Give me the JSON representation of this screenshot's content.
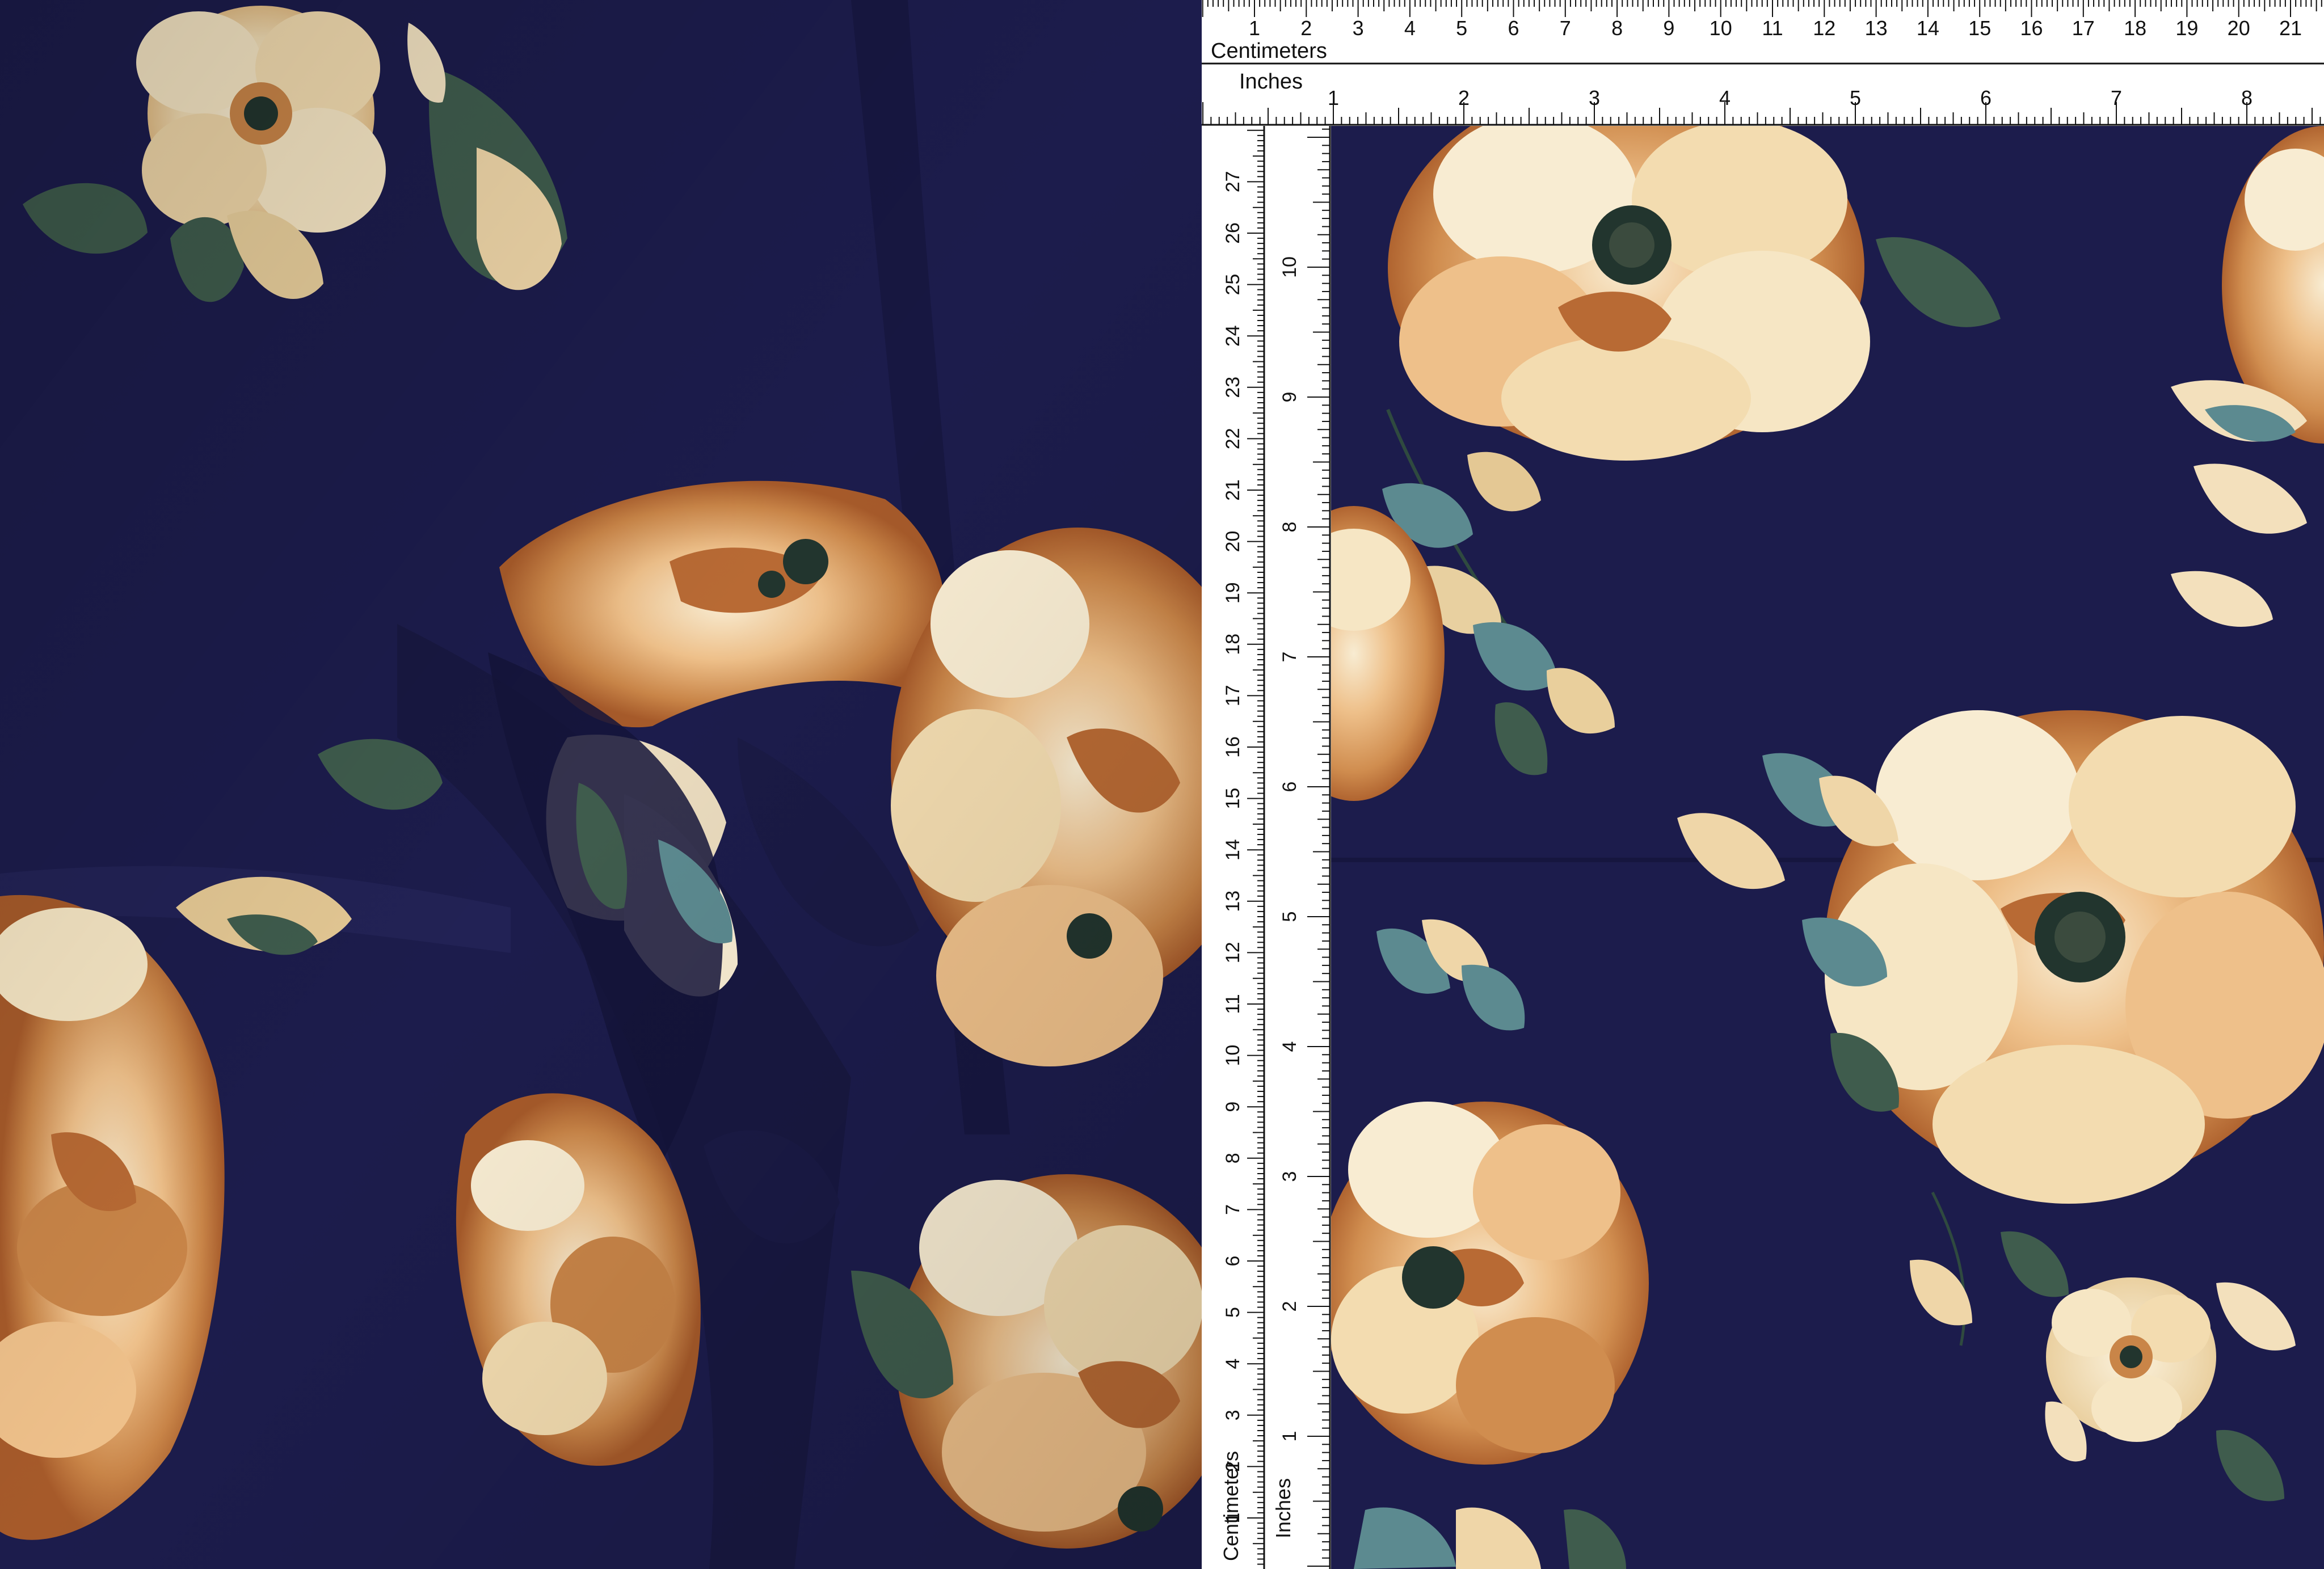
{
  "top_ruler": {
    "cm_unit_label": "Centimeters",
    "in_unit_label": "Inches",
    "cm_numbers": [
      "1",
      "2",
      "3",
      "4",
      "5",
      "6",
      "7",
      "8",
      "9",
      "10",
      "11",
      "12",
      "13",
      "14",
      "15",
      "16",
      "17",
      "18",
      "19",
      "20",
      "21"
    ],
    "in_numbers": [
      "1",
      "2",
      "3",
      "4",
      "5",
      "6",
      "7",
      "8"
    ]
  },
  "side_ruler": {
    "cm_unit_label": "Centimeters",
    "in_unit_label": "Inches",
    "cm_numbers": [
      "1",
      "2",
      "3",
      "4",
      "5",
      "6",
      "7",
      "8",
      "9",
      "10",
      "11",
      "12",
      "13",
      "14",
      "15",
      "16",
      "17",
      "18",
      "19",
      "20",
      "21",
      "22",
      "23",
      "24",
      "25",
      "26",
      "27"
    ],
    "in_numbers": [
      "1",
      "2",
      "3",
      "4",
      "5",
      "6",
      "7",
      "8",
      "9",
      "10"
    ]
  },
  "palette": {
    "fabric_navy": "#1c1c4c",
    "fabric_navy_dark": "#12122f",
    "petal_cream": "#f6e6c4",
    "petal_peach": "#e7b077",
    "petal_rust": "#b86a34",
    "flower_center": "#22352e",
    "leaf_green": "#3f5c4d",
    "leaf_teal": "#5c8a90",
    "ruler_bg": "#ffffff",
    "ruler_ink": "#111111"
  }
}
